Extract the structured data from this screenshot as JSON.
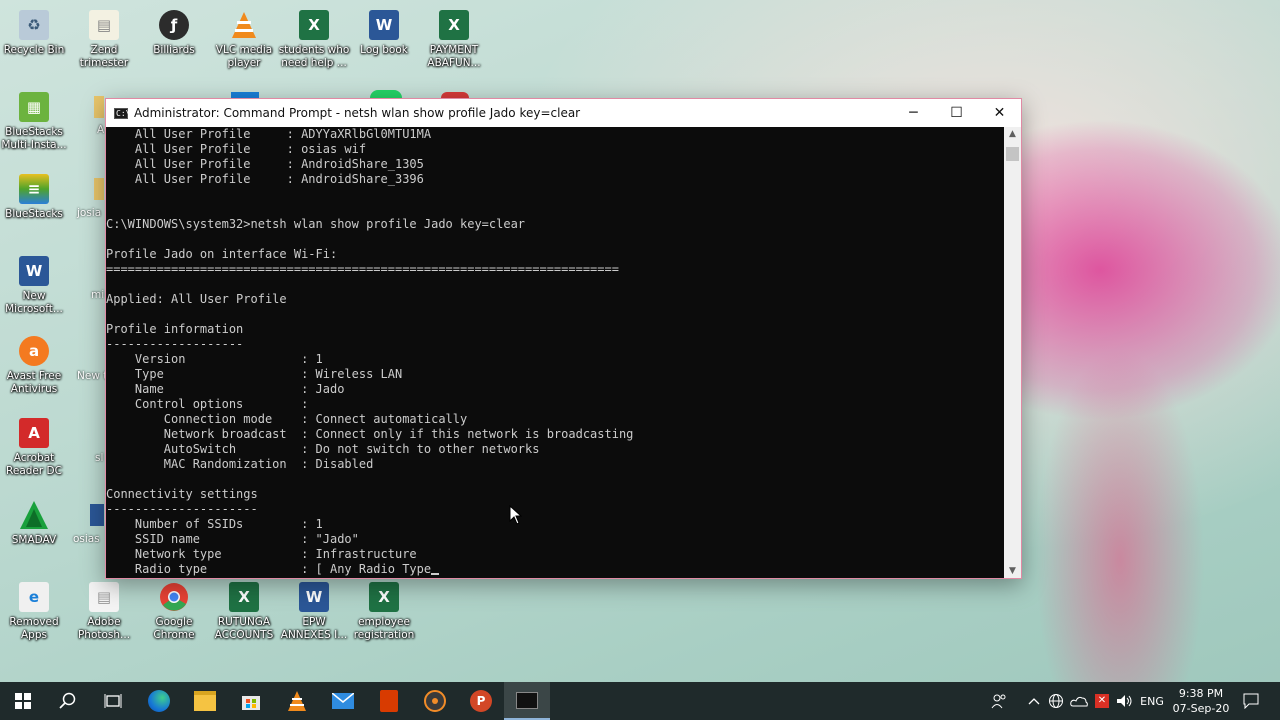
{
  "desktop": {
    "icons": [
      {
        "label": "Recycle Bin",
        "icon": "recycle-bin-icon",
        "color": "#9fb6c9"
      },
      {
        "label": "Zend trimester",
        "icon": "document-icon",
        "color": "#f0f0e6"
      },
      {
        "label": "Billiards",
        "icon": "flash-icon",
        "color": "#1e1e1e"
      },
      {
        "label": "VLC media player",
        "icon": "vlc-icon",
        "color": "#f08a1c"
      },
      {
        "label": "students who need help ...",
        "icon": "excel-icon",
        "color": "#1f7244"
      },
      {
        "label": "Log book",
        "icon": "word-icon",
        "color": "#2b5797"
      },
      {
        "label": "PAYMENT ABAFUN...",
        "icon": "excel-icon",
        "color": "#1f7244"
      },
      {
        "label": "BlueStacks Multi-Insta...",
        "icon": "bluestacks-icon",
        "color": "#6cb33f"
      },
      {
        "label": "BlueStacks",
        "icon": "bluestacks-icon",
        "color": "#4fa32b"
      },
      {
        "label": "New Microsoft...",
        "icon": "word-icon",
        "color": "#2b5797"
      },
      {
        "label": "Avast Free Antivirus",
        "icon": "avast-icon",
        "color": "#f47a20"
      },
      {
        "label": "Acrobat Reader DC",
        "icon": "acrobat-icon",
        "color": "#d32a2a"
      },
      {
        "label": "SMADAV",
        "icon": "smadav-icon",
        "color": "#19a03c"
      },
      {
        "label": "Removed Apps",
        "icon": "edge-icon",
        "color": "#1a7fd8"
      },
      {
        "label": "Adobe Photosh...",
        "icon": "document-icon",
        "color": "#f0f0f0"
      },
      {
        "label": "Google Chrome",
        "icon": "chrome-icon",
        "color": "#e94235"
      },
      {
        "label": "RUTUNGA ACCOUNTS",
        "icon": "excel-icon",
        "color": "#1f7244"
      },
      {
        "label": "EPW ANNEXES I...",
        "icon": "word-icon",
        "color": "#2b5797"
      },
      {
        "label": "employee registration",
        "icon": "excel-icon",
        "color": "#1f7244"
      }
    ],
    "partial_labels": {
      "a": "A",
      "josia": "josia",
      "mi": "mi",
      "newt": "New t",
      "sl": "sl",
      "osias": "osias"
    }
  },
  "window": {
    "title": "Administrator: Command Prompt - netsh  wlan show profile Jado key=clear",
    "minimize": "─",
    "maximize": "☐",
    "close": "✕"
  },
  "console_lines": [
    "    All User Profile     : ADYYaXRlbGl0MTU1MA",
    "    All User Profile     : osias wif",
    "    All User Profile     : AndroidShare_1305",
    "    All User Profile     : AndroidShare_3396",
    "",
    "",
    "C:\\WINDOWS\\system32>netsh wlan show profile Jado key=clear",
    "",
    "Profile Jado on interface Wi-Fi:",
    "=======================================================================",
    "",
    "Applied: All User Profile",
    "",
    "Profile information",
    "-------------------",
    "    Version                : 1",
    "    Type                   : Wireless LAN",
    "    Name                   : Jado",
    "    Control options        :",
    "        Connection mode    : Connect automatically",
    "        Network broadcast  : Connect only if this network is broadcasting",
    "        AutoSwitch         : Do not switch to other networks",
    "        MAC Randomization  : Disabled",
    "",
    "Connectivity settings",
    "---------------------",
    "    Number of SSIDs        : 1",
    "    SSID name              : \"Jado\"",
    "    Network type           : Infrastructure",
    "    Radio type             : [ Any Radio Type"
  ],
  "taskbar": {
    "items": [
      "start-icon",
      "search-icon",
      "task-view-icon",
      "edge-icon",
      "file-explorer-icon",
      "store-icon",
      "vlc-icon",
      "mail-icon",
      "office-icon",
      "media-player-icon",
      "powerpoint-icon",
      "command-prompt-icon"
    ],
    "tray": {
      "language": "ENG",
      "time": "9:38 PM",
      "date": "07-Sep-20"
    }
  }
}
